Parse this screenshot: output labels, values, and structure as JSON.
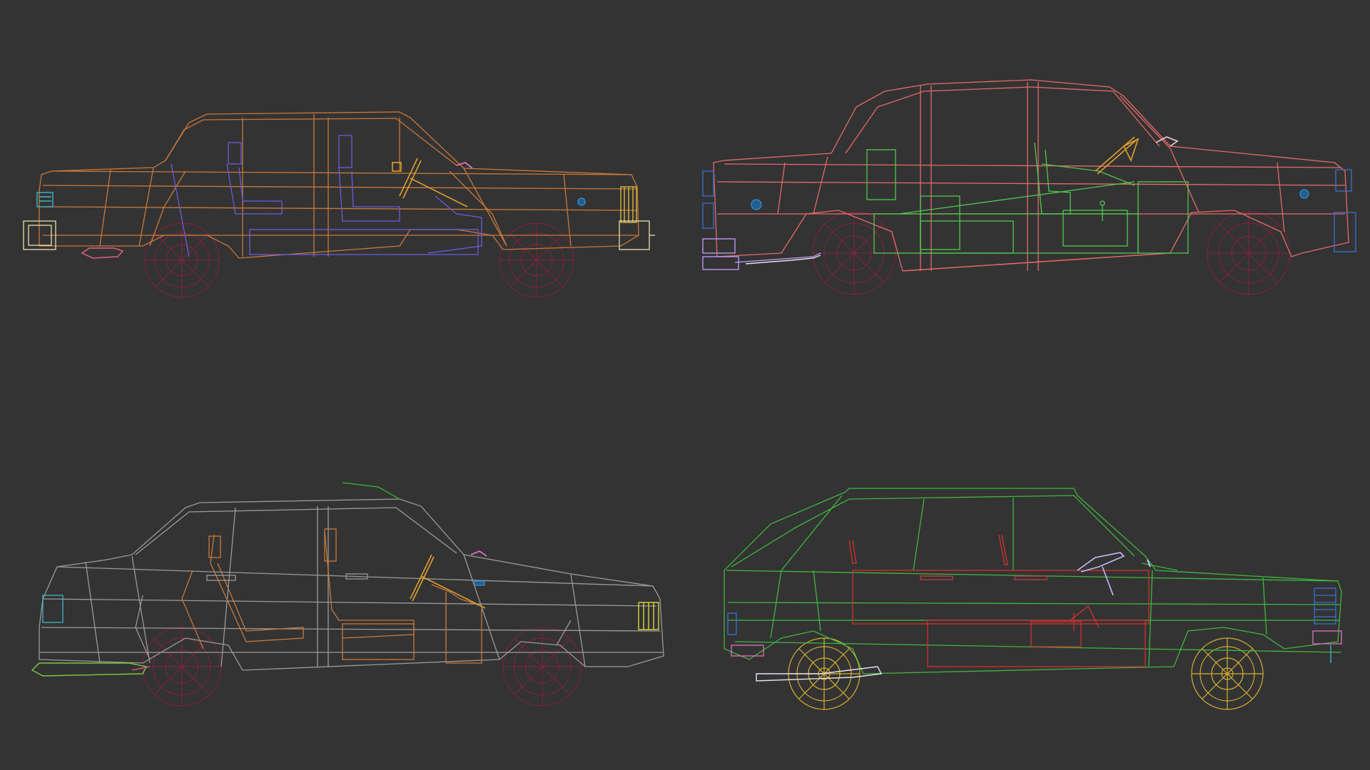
{
  "scene": {
    "background": "#333333",
    "models": [
      {
        "id": "car-top-left",
        "body_color": "#c9783a",
        "interior_color": "#6a5ce0",
        "accent_color": "#e0a030",
        "wheel_color": "#8a2040"
      },
      {
        "id": "car-top-right",
        "body_color": "#e56a6a",
        "interior_color": "#4ec94e",
        "accent_color": "#e0a030",
        "wheel_color": "#8a2040"
      },
      {
        "id": "car-bottom-left",
        "body_color": "#9a9a9a",
        "interior_color": "#c9783a",
        "accent_color": "#e0a030",
        "wheel_color": "#8a2040"
      },
      {
        "id": "car-bottom-right",
        "body_color": "#3fb63f",
        "interior_color": "#d43030",
        "accent_color": "#c0c0ff",
        "wheel_color": "#d4b030"
      }
    ]
  }
}
